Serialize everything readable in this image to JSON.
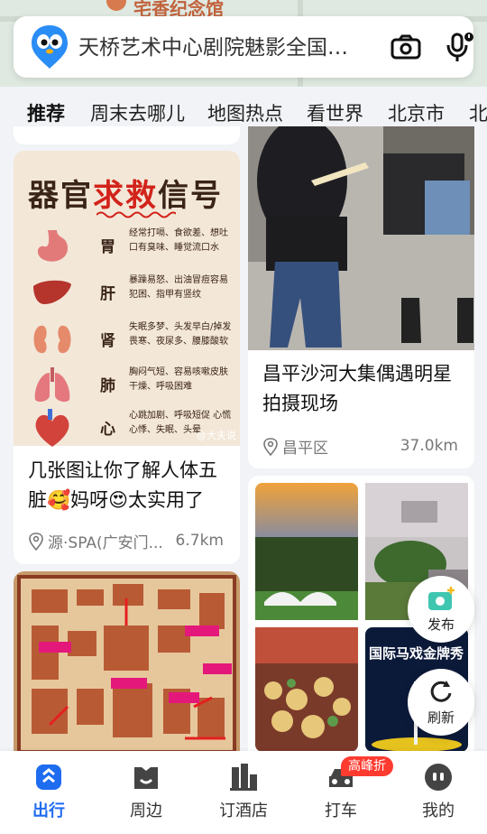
{
  "map": {
    "landmark": "宅香纪念馆"
  },
  "search": {
    "query": "天桥艺术中心剧院魅影全国巡演"
  },
  "tabs": [
    "推荐",
    "周末去哪儿",
    "地图热点",
    "看世界",
    "北京市",
    "北"
  ],
  "cards": {
    "health": {
      "poster_title_a": "器官",
      "poster_title_b": "求救",
      "poster_title_c": "信号",
      "organs": [
        {
          "name": "胃",
          "desc": "经常打嗝、食欲差、想吐 口有臭味、睡觉流口水"
        },
        {
          "name": "肝",
          "desc": "暴躁易怒、出油冒痘容易 犯困、指甲有竖纹"
        },
        {
          "name": "肾",
          "desc": "失眠多梦、头发早白/掉发 畏寒、夜尿多、腰膝酸软"
        },
        {
          "name": "肺",
          "desc": "胸闷气短、容易咳嗽皮肤 干燥、呼吸困难"
        },
        {
          "name": "心",
          "desc": "心跳加剧、呼吸短促 心慌心悸、失眠、头晕"
        }
      ],
      "watermark": "@大夫说",
      "title": "几张图让你了解人体五脏🥰妈呀😍太实用了",
      "location": "源·SPA(广安门...",
      "distance": "6.7km"
    },
    "celebrity": {
      "title": "昌平沙河大集偶遇明星拍摄现场",
      "location": "昌平区",
      "distance": "37.0km"
    },
    "circus": {
      "overlay_text": "国际马戏金牌秀"
    }
  },
  "fabs": {
    "publish": "发布",
    "refresh": "刷新"
  },
  "bottom_nav": [
    {
      "label": "出行",
      "icon": "travel-icon"
    },
    {
      "label": "周边",
      "icon": "nearby-icon"
    },
    {
      "label": "订酒店",
      "icon": "hotel-icon"
    },
    {
      "label": "打车",
      "icon": "taxi-icon"
    },
    {
      "label": "我的",
      "icon": "profile-icon"
    }
  ],
  "taxi_badge": "高峰折",
  "colors": {
    "accent": "#1e6cf0",
    "badge": "#ff3b30"
  }
}
